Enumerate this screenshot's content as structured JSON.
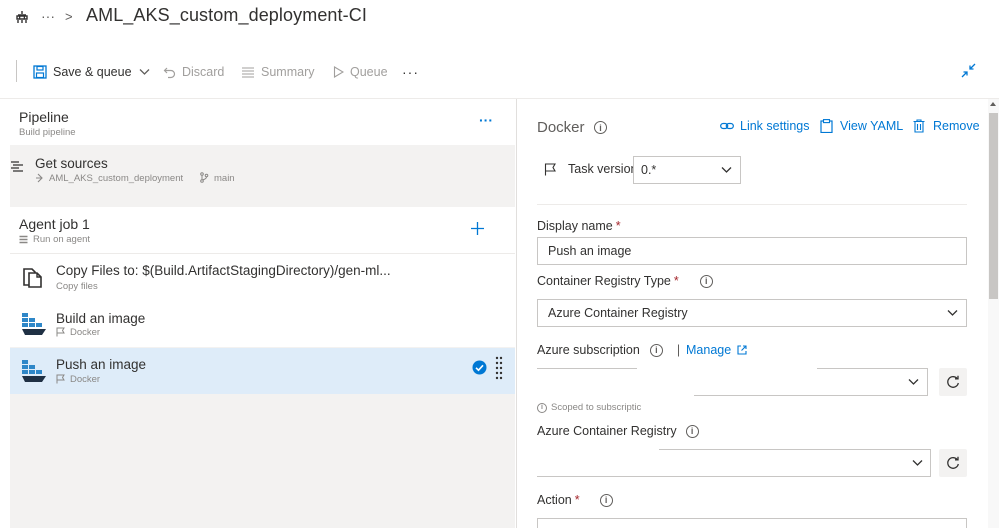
{
  "header": {
    "more_glyph": "···",
    "chevron": ">",
    "title": "AML_AKS_custom_deployment-CI"
  },
  "toolbar": {
    "save_queue": "Save & queue",
    "discard": "Discard",
    "summary": "Summary",
    "queue": "Queue",
    "more": "···"
  },
  "pipeline": {
    "title": "Pipeline",
    "subtitle": "Build pipeline",
    "more": "···"
  },
  "get_sources": {
    "title": "Get sources",
    "repo": "AML_AKS_custom_deployment",
    "branch": "main"
  },
  "agent_job": {
    "title": "Agent job 1",
    "subtitle": "Run on agent"
  },
  "tasks": [
    {
      "title": "Copy Files to: $(Build.ArtifactStagingDirectory)/gen-ml...",
      "subtitle": "Copy files",
      "selected": false
    },
    {
      "title": "Build an image",
      "subtitle": "Docker",
      "selected": false
    },
    {
      "title": "Push an image",
      "subtitle": "Docker",
      "selected": true
    }
  ],
  "details": {
    "task_title": "Docker",
    "link_settings": "Link settings",
    "view_yaml": "View YAML",
    "remove": "Remove",
    "task_version_label": "Task version",
    "task_version_value": "0.*",
    "display_name_label": "Display name",
    "display_name_value": "Push an image",
    "container_registry_type_label": "Container Registry Type",
    "container_registry_type_value": "Azure Container Registry",
    "azure_subscription_label": "Azure subscription",
    "manage": "Manage",
    "separator": "|",
    "scoped_note": "Scoped to subscriptic",
    "acr_label": "Azure Container Registry",
    "action_label": "Action",
    "required_mark": "*",
    "info_glyph": "i"
  },
  "colors": {
    "accent": "#0078d4",
    "selected_row": "#deecf9",
    "panel_bg": "#f3f2f1",
    "required": "#a4262c"
  }
}
